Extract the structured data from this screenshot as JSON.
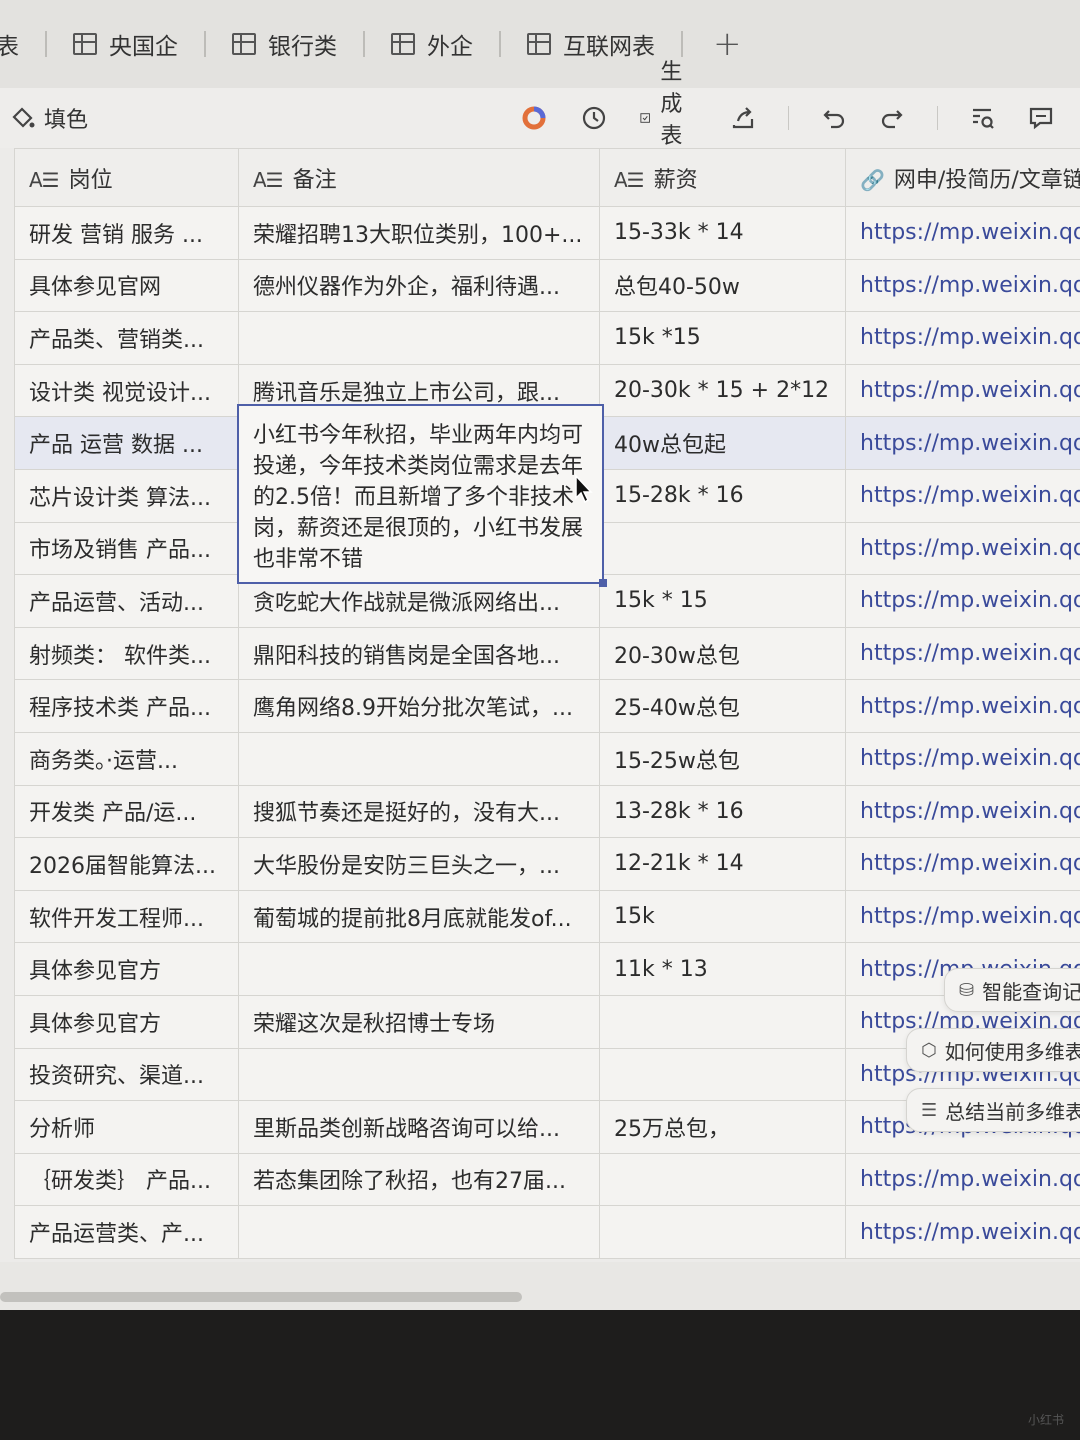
{
  "tabs": [
    {
      "label": "表",
      "partial": true
    },
    {
      "label": "央国企"
    },
    {
      "label": "银行类"
    },
    {
      "label": "外企"
    },
    {
      "label": "互联网表"
    }
  ],
  "tab_add_icon": "plus-icon",
  "toolbar": {
    "fill_label": "填色",
    "generate_form_label": "生成表单",
    "icons": [
      "fill-icon",
      "ai-ring-icon",
      "history-icon",
      "form-icon",
      "share-icon",
      "undo-icon",
      "redo-icon",
      "search-icon",
      "comment-icon"
    ]
  },
  "table": {
    "headers": [
      {
        "icon": "A☰",
        "label": "岗位"
      },
      {
        "icon": "A☰",
        "label": "备注"
      },
      {
        "icon": "A☰",
        "label": "薪资"
      },
      {
        "icon": "🔗",
        "label": "网申/投简历/文章链接"
      }
    ],
    "rows": [
      {
        "position": "研发 营销 服务 ...",
        "note": "荣耀招聘13大职位类别，100+...",
        "salary": "15-33k * 14",
        "link": "https://mp.weixin.qq.com"
      },
      {
        "position": "具体参见官网",
        "note": "德州仪器作为外企，福利待遇...",
        "salary": "总包40-50w",
        "link": "https://mp.weixin.qq.com"
      },
      {
        "position": "产品类、营销类...",
        "note": "",
        "salary": "15k *15",
        "link": "https://mp.weixin.qq.com"
      },
      {
        "position": "设计类 视觉设计...",
        "note": "腾讯音乐是独立上市公司，跟...",
        "salary": "20-30k * 15 + 2*12",
        "link": "https://mp.weixin.qq.com"
      },
      {
        "position": "产品 运营 数据 ...",
        "note": "",
        "salary": "40w总包起",
        "link": "https://mp.weixin.qq.com",
        "selected": true
      },
      {
        "position": "芯片设计类 算法...",
        "note": "",
        "salary": "15-28k * 16",
        "link": "https://mp.weixin.qq.com"
      },
      {
        "position": "市场及销售 产品...",
        "note": "",
        "salary": "",
        "link": "https://mp.weixin.qq.com"
      },
      {
        "position": "产品运营、活动...",
        "note": "贪吃蛇大作战就是微派网络出...",
        "salary": "15k * 15",
        "link": "https://mp.weixin.qq.com"
      },
      {
        "position": "射频类： 软件类...",
        "note": "鼎阳科技的销售岗是全国各地...",
        "salary": "20-30w总包",
        "link": "https://mp.weixin.qq.com"
      },
      {
        "position": "程序技术类 产品...",
        "note": "鹰角网络8.9开始分批次笔试，...",
        "salary": "25-40w总包",
        "link": "https://mp.weixin.qq.com"
      },
      {
        "position": "商务类。·运营...",
        "note": "",
        "salary": "15-25w总包",
        "link": "https://mp.weixin.qq.com"
      },
      {
        "position": "开发类 产品/运...",
        "note": "搜狐节奏还是挺好的，没有大...",
        "salary": "13-28k * 16",
        "link": "https://mp.weixin.qq.com"
      },
      {
        "position": "2026届智能算法...",
        "note": "大华股份是安防三巨头之一，...",
        "salary": "12-21k * 14",
        "link": "https://mp.weixin.qq.com"
      },
      {
        "position": "软件开发工程师...",
        "note": "葡萄城的提前批8月底就能发of...",
        "salary": "15k",
        "link": "https://mp.weixin.qq.com"
      },
      {
        "position": "具体参见官方",
        "note": "",
        "salary": "11k * 13",
        "link": "https://mp.weixin.qq.com"
      },
      {
        "position": "具体参见官方",
        "note": "荣耀这次是秋招博士专场",
        "salary": "",
        "link": "https://mp.weixin.qq.com"
      },
      {
        "position": "投资研究、渠道...",
        "note": "",
        "salary": "",
        "link": "https://mp.weixin.qq.com"
      },
      {
        "position": "分析师",
        "note": "里斯品类创新战略咨询可以给...",
        "salary": "25万总包，",
        "link": "https://mp.weixin.qq.com"
      },
      {
        "position": "｛研发类｝ 产品...",
        "note": "若态集团除了秋招，也有27届...",
        "salary": "",
        "link": "https://mp.weixin.qq.com"
      },
      {
        "position": "产品运营类、产...",
        "note": "",
        "salary": "",
        "link": "https://mp.weixin.qq.com"
      }
    ]
  },
  "expanded_cell": {
    "text": "小红书今年秋招，毕业两年内均可投递，今年技术类岗位需求是去年的2.5倍！而且新增了多个非技术岗，薪资还是很顶的，小红书发展也非常不错"
  },
  "ai_chips": [
    {
      "icon": "database-icon",
      "label": "智能查询记录"
    },
    {
      "icon": "cube-icon",
      "label": "如何使用多维表格"
    },
    {
      "icon": "list-icon",
      "label": "总结当前多维表格"
    }
  ],
  "watermark": "小红书"
}
